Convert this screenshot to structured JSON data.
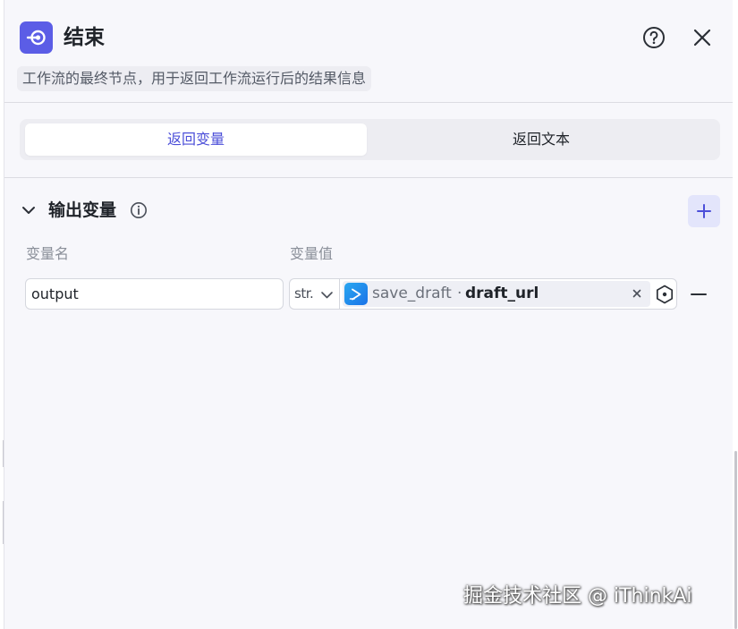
{
  "node": {
    "title": "结束",
    "description": "工作流的最终节点，用于返回工作流运行后的结果信息"
  },
  "tabs": [
    {
      "label": "返回变量",
      "active": true
    },
    {
      "label": "返回文本",
      "active": false
    }
  ],
  "output_section": {
    "title": "输出变量",
    "columns": {
      "name": "变量名",
      "value": "变量值"
    },
    "rows": [
      {
        "name": "output",
        "type": "str.",
        "ref_node": "save_draft",
        "ref_separator": "·",
        "ref_variable": "draft_url"
      }
    ]
  },
  "icons": {
    "node": "end-node-icon",
    "help": "help-circle-icon",
    "close": "close-icon",
    "chevron": "chevron-down-icon",
    "info": "info-icon",
    "add": "plus-icon",
    "ref": "play-node-icon",
    "clear": "clear-x-icon",
    "picker": "variable-picker-icon",
    "remove": "minus-icon"
  },
  "colors": {
    "accent": "#5b5de6",
    "tab_active_text": "#4c4fd9",
    "add_button_bg": "#e3e5fb"
  },
  "watermark": "掘金技术社区 @ iThinkAi"
}
